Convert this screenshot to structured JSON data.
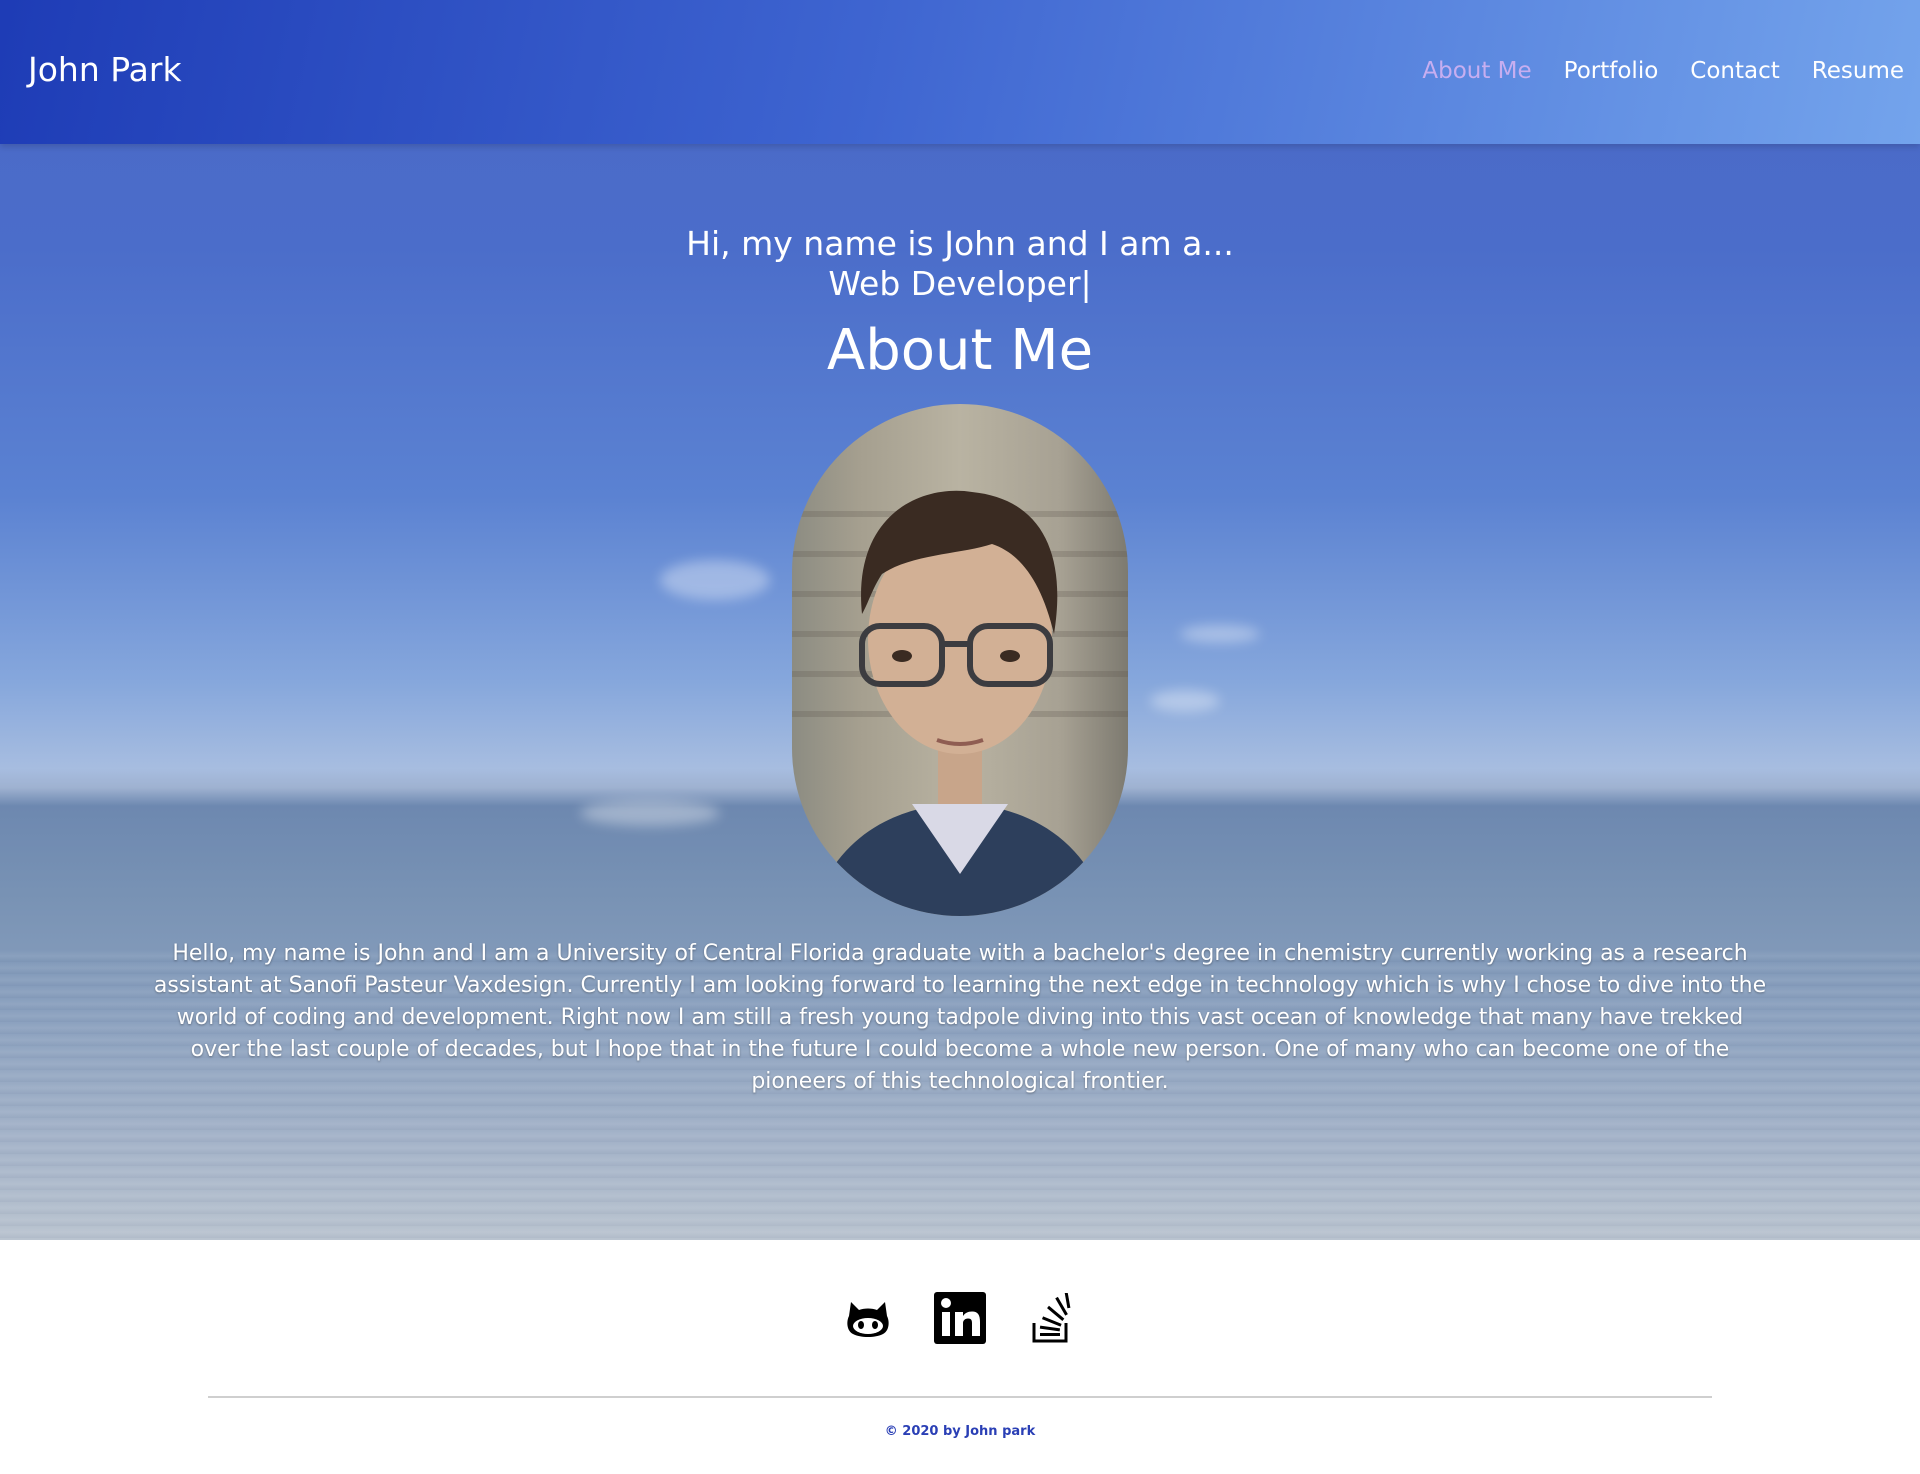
{
  "header": {
    "brand": "John Park",
    "nav": [
      "About Me",
      "Portfolio",
      "Contact",
      "Resume"
    ],
    "active_nav": "About Me"
  },
  "hero": {
    "intro_line1": "Hi, my name is John and I am a...",
    "intro_line2": "Web Developer|",
    "title": "About Me",
    "bio": "Hello, my name is John and I am a University of Central Florida graduate with a bachelor's degree in chemistry currently working as a research assistant at Sanofi Pasteur Vaxdesign. Currently I am looking forward to learning the next edge in technology which is why I chose to dive into the world of coding and development. Right now I am still a fresh young tadpole diving into this vast ocean of knowledge that many have trekked over the last couple of decades, but I hope that in the future I could become a whole new person. One of many who can become one of the pioneers of this technological frontier."
  },
  "footer": {
    "social_icons": [
      "github-icon",
      "linkedin-icon",
      "stackoverflow-icon"
    ],
    "copyright": "© 2020 by John park"
  },
  "colors": {
    "active_nav": "#c7aef0",
    "copyright": "#2a3fb5"
  }
}
